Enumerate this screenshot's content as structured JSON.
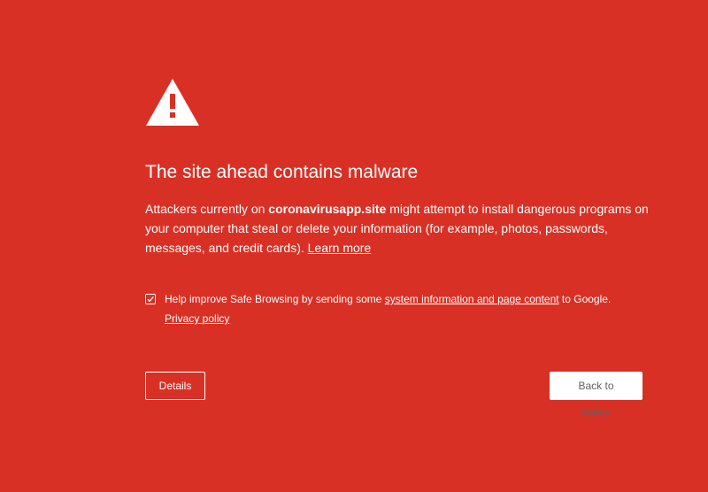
{
  "page": {
    "background_color": "#d93025",
    "text_color": "#ffffff"
  },
  "icon": {
    "name": "warning-triangle-icon"
  },
  "title": "The site ahead contains malware",
  "body": {
    "prefix": "Attackers currently on ",
    "site": "coronavirusapp.site",
    "suffix": " might attempt to install dangerous programs on your computer that steal or delete your information (for example, photos, passwords, messages, and credit cards). ",
    "learn_more": "Learn more"
  },
  "opt_in": {
    "checked": true,
    "prefix": "Help improve Safe Browsing by sending some ",
    "link": "system information and page content",
    "suffix": " to Google.",
    "privacy_policy": "Privacy policy"
  },
  "buttons": {
    "details": "Details",
    "back_to_safety": "Back to safety"
  }
}
